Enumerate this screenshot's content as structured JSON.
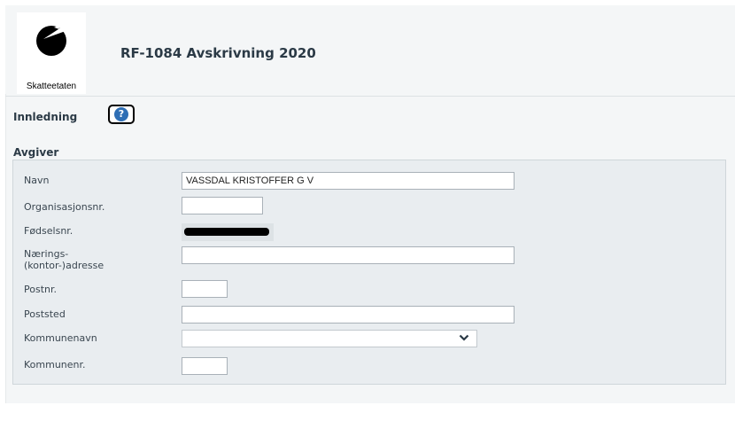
{
  "header": {
    "logo_text": "Skatteetaten",
    "title": "RF-1084 Avskrivning 2020"
  },
  "intro": {
    "label": "Innledning",
    "help_icon": "?"
  },
  "section": {
    "title": "Avgiver"
  },
  "fields": {
    "navn": {
      "label": "Navn",
      "value": "VASSDAL KRISTOFFER G V"
    },
    "orgnr": {
      "label": "Organisasjonsnr.",
      "value": ""
    },
    "fodselsnr": {
      "label": "Fødselsnr."
    },
    "adresse": {
      "label_line1": "Nærings-",
      "label_line2": "(kontor-)adresse",
      "value": ""
    },
    "postnr": {
      "label": "Postnr.",
      "value": ""
    },
    "poststed": {
      "label": "Poststed",
      "value": ""
    },
    "kommunenavn": {
      "label": "Kommunenavn",
      "value": ""
    },
    "kommunenr": {
      "label": "Kommunenr.",
      "value": ""
    }
  },
  "icons": {
    "logo": "skatteetaten-logo",
    "help": "help-icon",
    "dropdown": "chevron-down-icon"
  }
}
